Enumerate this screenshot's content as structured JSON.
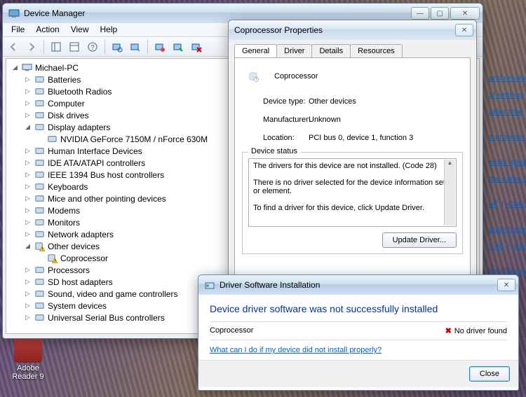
{
  "desktop": {
    "icon1_label": "Adobe\nReader 9"
  },
  "devmgr": {
    "title": "Device Manager",
    "menu": {
      "file": "File",
      "action": "Action",
      "view": "View",
      "help": "Help"
    },
    "root": "Michael-PC",
    "categories": [
      "Batteries",
      "Bluetooth Radios",
      "Computer",
      "Disk drives",
      "Display adapters",
      "Human Interface Devices",
      "IDE ATA/ATAPI controllers",
      "IEEE 1394 Bus host controllers",
      "Keyboards",
      "Mice and other pointing devices",
      "Modems",
      "Monitors",
      "Network adapters",
      "Other devices",
      "Processors",
      "SD host adapters",
      "Sound, video and game controllers",
      "System devices",
      "Universal Serial Bus controllers"
    ],
    "display_child": "NVIDIA GeForce 7150M / nForce 630M",
    "other_child": "Coprocessor"
  },
  "props": {
    "title": "Coprocessor Properties",
    "tabs": {
      "general": "General",
      "driver": "Driver",
      "details": "Details",
      "resources": "Resources"
    },
    "device_name": "Coprocessor",
    "fields": {
      "type_k": "Device type:",
      "type_v": "Other devices",
      "mfr_k": "Manufacturer:",
      "mfr_v": "Unknown",
      "loc_k": "Location:",
      "loc_v": "PCI bus 0, device 1, function 3"
    },
    "status_legend": "Device status",
    "status_line1": "The drivers for this device are not installed. (Code 28)",
    "status_line2": "There is no driver selected for the device information set or element.",
    "status_line3": "To find a driver for this device, click Update Driver.",
    "update_btn": "Update Driver..."
  },
  "drv": {
    "title": "Driver Software Installation",
    "heading": "Device driver software was not successfully installed",
    "device": "Coprocessor",
    "result": "No driver found",
    "help_link": "What can I do if my device did not install properly?",
    "close_btn": "Close"
  },
  "side": {
    "l1": "and resolve i",
    "l2": "ol settings",
    "l3": "arlier time",
    "l4": "a program th",
    "l5": "essor speed",
    "l6": "the name of",
    "l7": "off",
    "l7b": "Chec",
    "l8": "quire a passw",
    "l9": "s do",
    "l9b": "Cha",
    "l10": "tore files from"
  }
}
